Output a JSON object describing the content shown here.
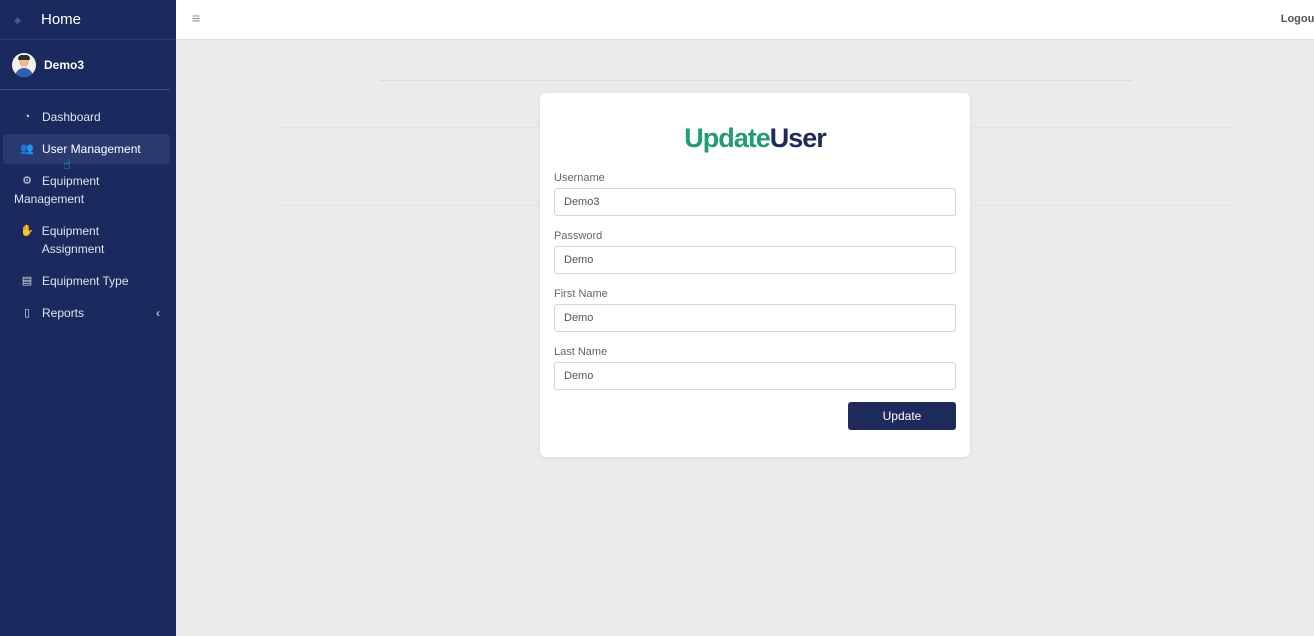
{
  "sidebar": {
    "brand": "Home",
    "user": "Demo3",
    "items": [
      {
        "label": "Dashboard",
        "icon": "gauge-icon"
      },
      {
        "label": "User Management",
        "icon": "users-icon"
      },
      {
        "label": "Equipment",
        "label2": "Management",
        "icon": "cogs-icon"
      },
      {
        "label": "Equipment Assignment",
        "icon": "handshake-icon"
      },
      {
        "label": "Equipment Type",
        "icon": "archive-icon"
      },
      {
        "label": "Reports",
        "icon": "file-icon"
      }
    ]
  },
  "topbar": {
    "logout": "Logout"
  },
  "form": {
    "title_part1": "Update",
    "title_part2": "User",
    "fields": [
      {
        "label": "Username",
        "value": "Demo3"
      },
      {
        "label": "Password",
        "value": "Demo"
      },
      {
        "label": "First Name",
        "value": "Demo"
      },
      {
        "label": "Last Name",
        "value": "Demo"
      }
    ],
    "submit": "Update"
  },
  "colors": {
    "sidebar_bg": "#1b2a5e",
    "accent_green": "#1f9e6f",
    "accent_navy": "#1f2a5c"
  }
}
